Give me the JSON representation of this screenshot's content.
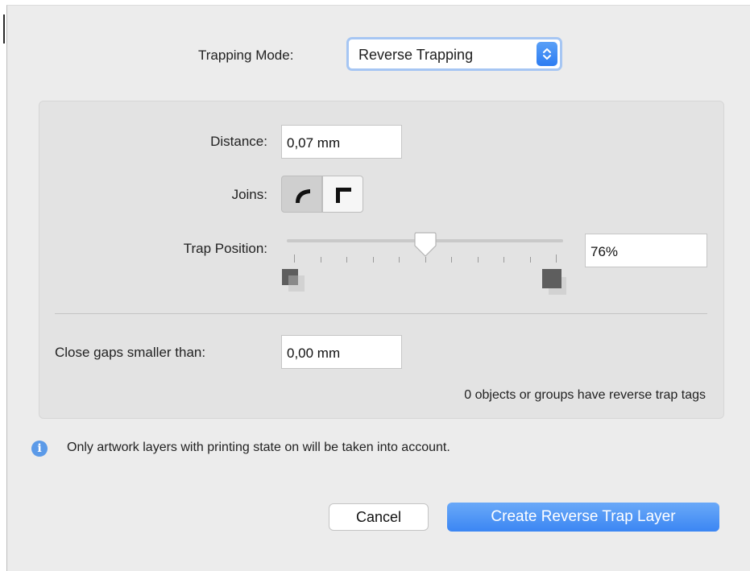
{
  "trapping_mode": {
    "label": "Trapping Mode:",
    "selected": "Reverse Trapping"
  },
  "distance": {
    "label": "Distance:",
    "value": "0,07 mm"
  },
  "joins": {
    "label": "Joins:",
    "options": [
      "round-join-icon",
      "miter-join-icon"
    ],
    "selected": "round-join-icon"
  },
  "trap_position": {
    "label": "Trap Position:",
    "slider_value": 0.5,
    "tick_count": 11,
    "value": "76%"
  },
  "close_gaps": {
    "label": "Close gaps smaller than:",
    "value": "0,00 mm"
  },
  "status": "0 objects or groups have reverse trap tags",
  "info": {
    "icon": "info-icon",
    "text": "Only artwork layers with printing state on will be taken into account."
  },
  "buttons": {
    "cancel": "Cancel",
    "create": "Create Reverse Trap Layer"
  },
  "colors": {
    "accent": "#3b86f3",
    "panel": "#ececec",
    "group": "#e3e3e3"
  }
}
